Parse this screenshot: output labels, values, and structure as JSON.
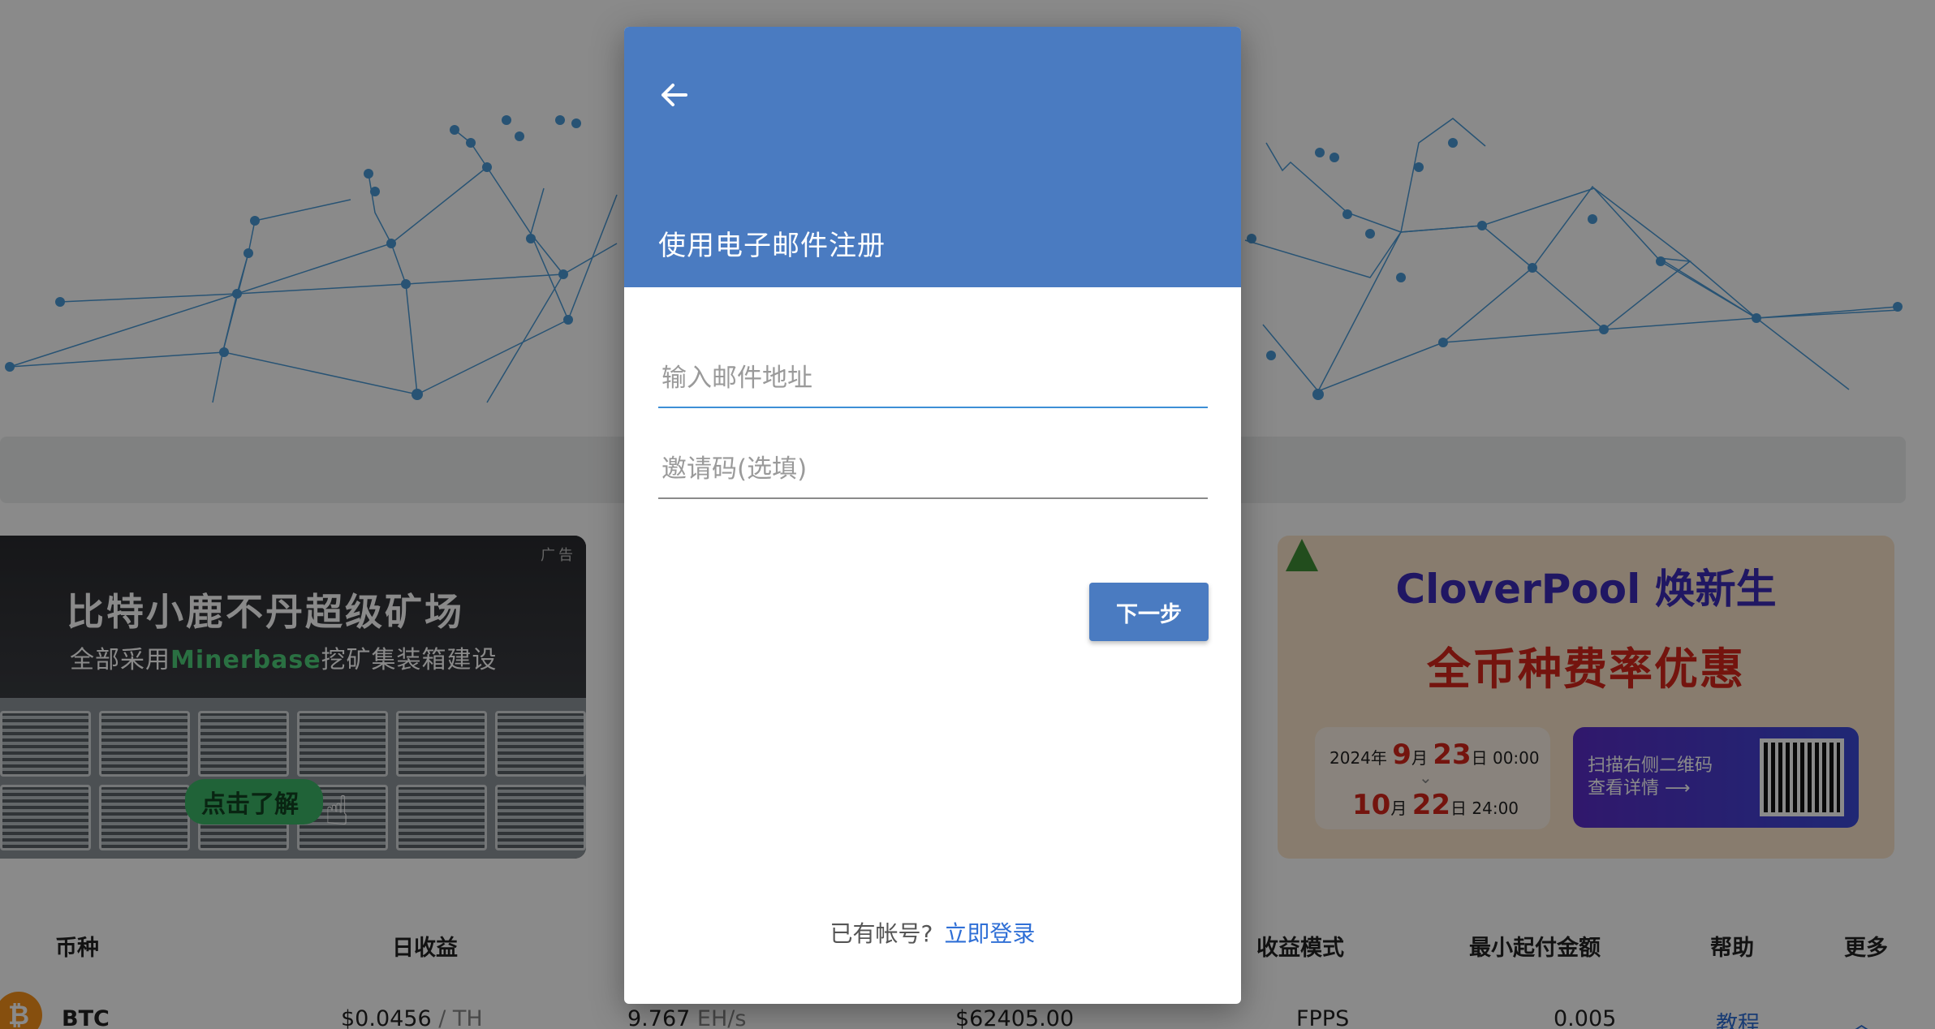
{
  "modal": {
    "title": "使用电子邮件注册",
    "email_placeholder": "输入邮件地址",
    "invite_placeholder": "邀请码(选填)",
    "next_label": "下一步",
    "has_account": "已有帐号?",
    "login_link": "立即登录"
  },
  "ad_left": {
    "tag": "广告",
    "headline": "比特小鹿不丹超级矿场",
    "sub_prefix": "全部采用",
    "sub_highlight": "Minerbase",
    "sub_suffix": "挖矿集装箱建设",
    "cta": "点击了解"
  },
  "ad_right": {
    "brand": "CloverPool 焕新生",
    "promo": "全币种费率优惠",
    "start": {
      "year": "2024年",
      "month": "9",
      "m_unit": "月",
      "day": "23",
      "d_unit": "日",
      "time": "00:00"
    },
    "end": {
      "month": "10",
      "m_unit": "月",
      "day": "22",
      "d_unit": "日",
      "time": "24:00"
    },
    "qr_line1": "扫描右侧二维码",
    "qr_line2": "查看详情"
  },
  "table": {
    "headers": {
      "coin": "币种",
      "daily": "日收益",
      "mode": "收益模式",
      "min_pay": "最小起付金额",
      "help": "帮助",
      "more": "更多"
    },
    "row": {
      "coin": "BTC",
      "daily_value": "$0.0456",
      "daily_unit": "/ TH",
      "hashrate_value": "9.767",
      "hashrate_unit": "EH/s",
      "price": "$62405.00",
      "mode": "FPPS",
      "min_pay": "0.005",
      "help": "教程"
    }
  },
  "colors": {
    "header_blue": "#4a7bc1",
    "link_blue": "#2f6fd6",
    "focus_blue": "#3d8fd6"
  }
}
